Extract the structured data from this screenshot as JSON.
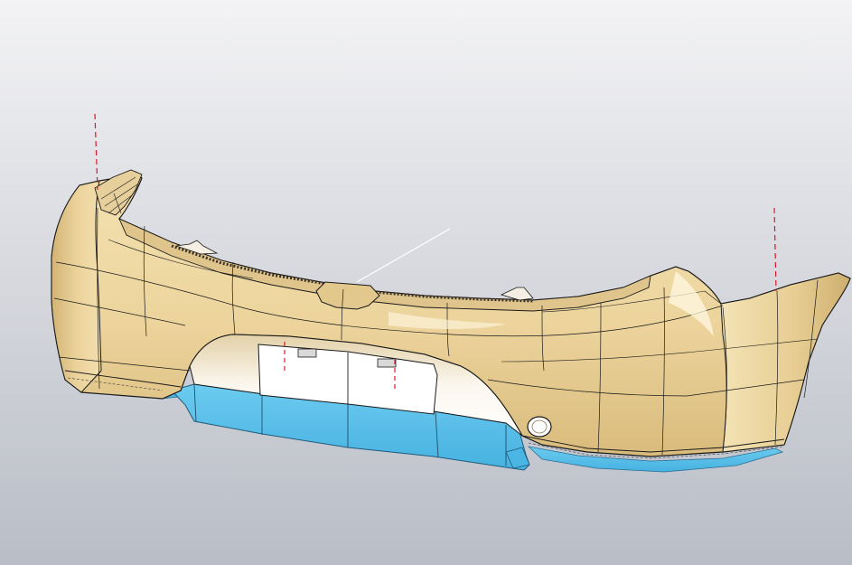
{
  "viewport": {
    "background_top": "#f3f3f5",
    "background_bottom": "#b9bdc6"
  },
  "model": {
    "part_name": "rear-bumper",
    "fascia_color": "#eed9a3",
    "fascia_shadow_color": "#c9ac6f",
    "fascia_highlight_color": "#fff6dd",
    "lower_diffuser_color": "#5cc0ea",
    "edge_color": "#1a1a1a",
    "datum_line_color": "#d8172a",
    "view_direction_line_color": "#ffffff"
  }
}
